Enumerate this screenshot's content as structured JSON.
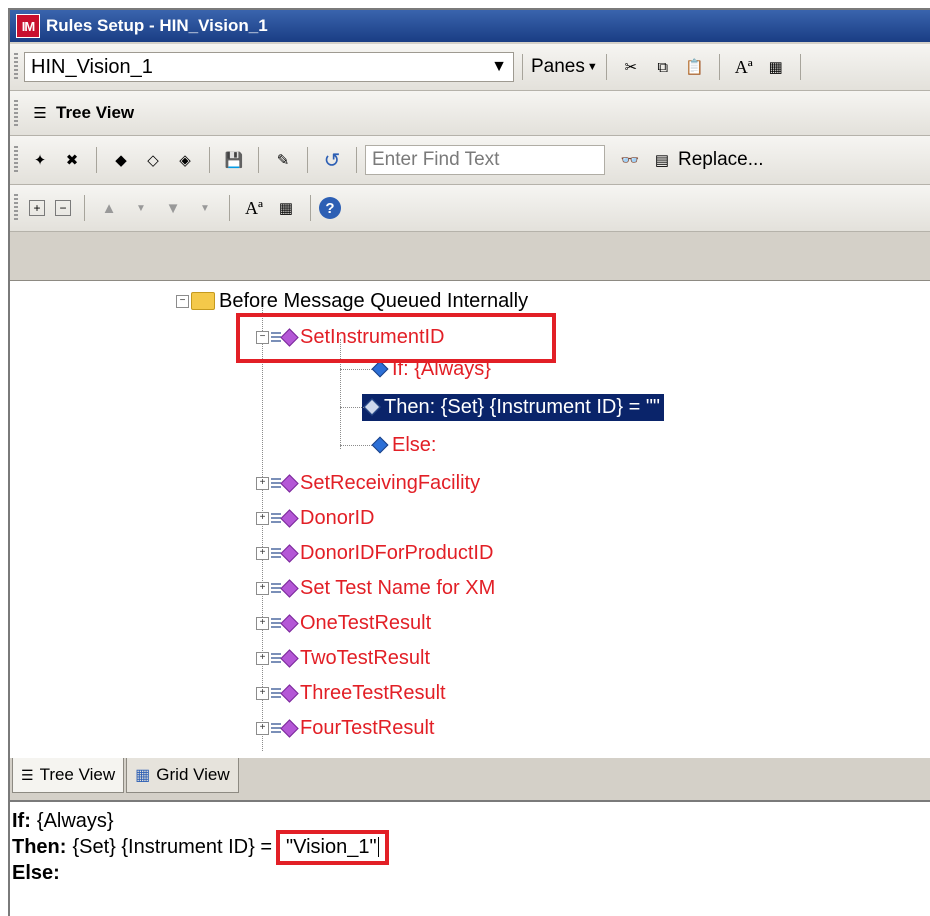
{
  "window": {
    "title": "Rules Setup - HIN_Vision_1",
    "logo": "IM"
  },
  "toolbar1": {
    "combo_value": "HIN_Vision_1",
    "panes_label": "Panes"
  },
  "toolbar2": {
    "label": "Tree View"
  },
  "toolbar3": {
    "find_placeholder": "Enter Find Text",
    "replace_label": "Replace..."
  },
  "tree": {
    "root": "Before Message Queued Internally",
    "expanded_rule": "SetInstrumentID",
    "children": {
      "if": "If: {Always}",
      "then": "Then: {Set} {Instrument ID} = \"\"",
      "else": "Else:"
    },
    "rules": [
      "SetReceivingFacility",
      "DonorID",
      "DonorIDForProductID",
      "Set Test Name for XM",
      "OneTestResult",
      "TwoTestResult",
      "ThreeTestResult",
      "FourTestResult"
    ]
  },
  "tabs": [
    {
      "label": "Tree View"
    },
    {
      "label": "Grid View"
    }
  ],
  "editor": {
    "if_kw": "If:",
    "if_val": "{Always}",
    "then_kw": "Then:",
    "then_val": "{Set} {Instrument ID} =",
    "then_value": "\"Vision_1\"",
    "else_kw": "Else:"
  },
  "colors": {
    "rule_red": "#e21f26",
    "selection": "#0a246a",
    "title_blue": "#1a3d84"
  }
}
